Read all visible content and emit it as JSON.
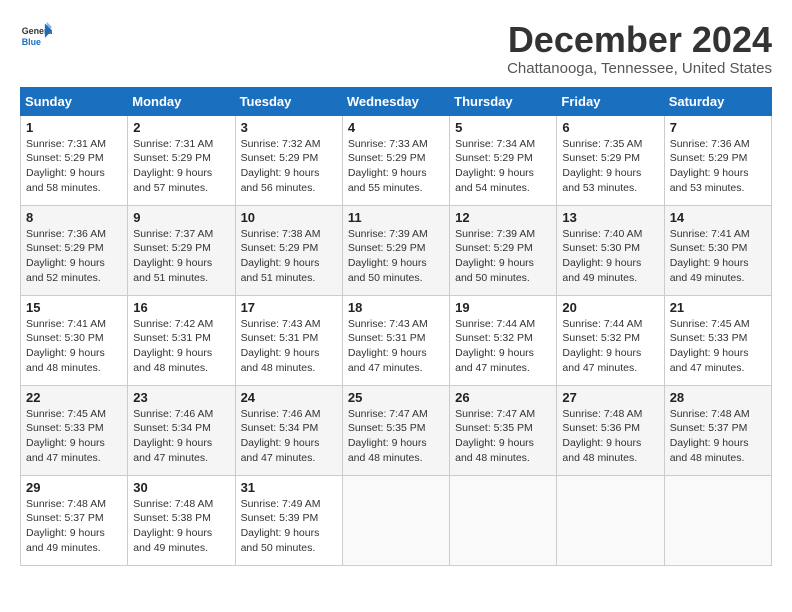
{
  "logo": {
    "general": "General",
    "blue": "Blue"
  },
  "title": "December 2024",
  "location": "Chattanooga, Tennessee, United States",
  "headers": [
    "Sunday",
    "Monday",
    "Tuesday",
    "Wednesday",
    "Thursday",
    "Friday",
    "Saturday"
  ],
  "weeks": [
    [
      {
        "day": "1",
        "sunrise": "7:31 AM",
        "sunset": "5:29 PM",
        "daylight": "9 hours and 58 minutes."
      },
      {
        "day": "2",
        "sunrise": "7:31 AM",
        "sunset": "5:29 PM",
        "daylight": "9 hours and 57 minutes."
      },
      {
        "day": "3",
        "sunrise": "7:32 AM",
        "sunset": "5:29 PM",
        "daylight": "9 hours and 56 minutes."
      },
      {
        "day": "4",
        "sunrise": "7:33 AM",
        "sunset": "5:29 PM",
        "daylight": "9 hours and 55 minutes."
      },
      {
        "day": "5",
        "sunrise": "7:34 AM",
        "sunset": "5:29 PM",
        "daylight": "9 hours and 54 minutes."
      },
      {
        "day": "6",
        "sunrise": "7:35 AM",
        "sunset": "5:29 PM",
        "daylight": "9 hours and 53 minutes."
      },
      {
        "day": "7",
        "sunrise": "7:36 AM",
        "sunset": "5:29 PM",
        "daylight": "9 hours and 53 minutes."
      }
    ],
    [
      {
        "day": "8",
        "sunrise": "7:36 AM",
        "sunset": "5:29 PM",
        "daylight": "9 hours and 52 minutes."
      },
      {
        "day": "9",
        "sunrise": "7:37 AM",
        "sunset": "5:29 PM",
        "daylight": "9 hours and 51 minutes."
      },
      {
        "day": "10",
        "sunrise": "7:38 AM",
        "sunset": "5:29 PM",
        "daylight": "9 hours and 51 minutes."
      },
      {
        "day": "11",
        "sunrise": "7:39 AM",
        "sunset": "5:29 PM",
        "daylight": "9 hours and 50 minutes."
      },
      {
        "day": "12",
        "sunrise": "7:39 AM",
        "sunset": "5:29 PM",
        "daylight": "9 hours and 50 minutes."
      },
      {
        "day": "13",
        "sunrise": "7:40 AM",
        "sunset": "5:30 PM",
        "daylight": "9 hours and 49 minutes."
      },
      {
        "day": "14",
        "sunrise": "7:41 AM",
        "sunset": "5:30 PM",
        "daylight": "9 hours and 49 minutes."
      }
    ],
    [
      {
        "day": "15",
        "sunrise": "7:41 AM",
        "sunset": "5:30 PM",
        "daylight": "9 hours and 48 minutes."
      },
      {
        "day": "16",
        "sunrise": "7:42 AM",
        "sunset": "5:31 PM",
        "daylight": "9 hours and 48 minutes."
      },
      {
        "day": "17",
        "sunrise": "7:43 AM",
        "sunset": "5:31 PM",
        "daylight": "9 hours and 48 minutes."
      },
      {
        "day": "18",
        "sunrise": "7:43 AM",
        "sunset": "5:31 PM",
        "daylight": "9 hours and 47 minutes."
      },
      {
        "day": "19",
        "sunrise": "7:44 AM",
        "sunset": "5:32 PM",
        "daylight": "9 hours and 47 minutes."
      },
      {
        "day": "20",
        "sunrise": "7:44 AM",
        "sunset": "5:32 PM",
        "daylight": "9 hours and 47 minutes."
      },
      {
        "day": "21",
        "sunrise": "7:45 AM",
        "sunset": "5:33 PM",
        "daylight": "9 hours and 47 minutes."
      }
    ],
    [
      {
        "day": "22",
        "sunrise": "7:45 AM",
        "sunset": "5:33 PM",
        "daylight": "9 hours and 47 minutes."
      },
      {
        "day": "23",
        "sunrise": "7:46 AM",
        "sunset": "5:34 PM",
        "daylight": "9 hours and 47 minutes."
      },
      {
        "day": "24",
        "sunrise": "7:46 AM",
        "sunset": "5:34 PM",
        "daylight": "9 hours and 47 minutes."
      },
      {
        "day": "25",
        "sunrise": "7:47 AM",
        "sunset": "5:35 PM",
        "daylight": "9 hours and 48 minutes."
      },
      {
        "day": "26",
        "sunrise": "7:47 AM",
        "sunset": "5:35 PM",
        "daylight": "9 hours and 48 minutes."
      },
      {
        "day": "27",
        "sunrise": "7:48 AM",
        "sunset": "5:36 PM",
        "daylight": "9 hours and 48 minutes."
      },
      {
        "day": "28",
        "sunrise": "7:48 AM",
        "sunset": "5:37 PM",
        "daylight": "9 hours and 48 minutes."
      }
    ],
    [
      {
        "day": "29",
        "sunrise": "7:48 AM",
        "sunset": "5:37 PM",
        "daylight": "9 hours and 49 minutes."
      },
      {
        "day": "30",
        "sunrise": "7:48 AM",
        "sunset": "5:38 PM",
        "daylight": "9 hours and 49 minutes."
      },
      {
        "day": "31",
        "sunrise": "7:49 AM",
        "sunset": "5:39 PM",
        "daylight": "9 hours and 50 minutes."
      },
      null,
      null,
      null,
      null
    ]
  ],
  "labels": {
    "sunrise": "Sunrise:",
    "sunset": "Sunset:",
    "daylight": "Daylight:"
  }
}
